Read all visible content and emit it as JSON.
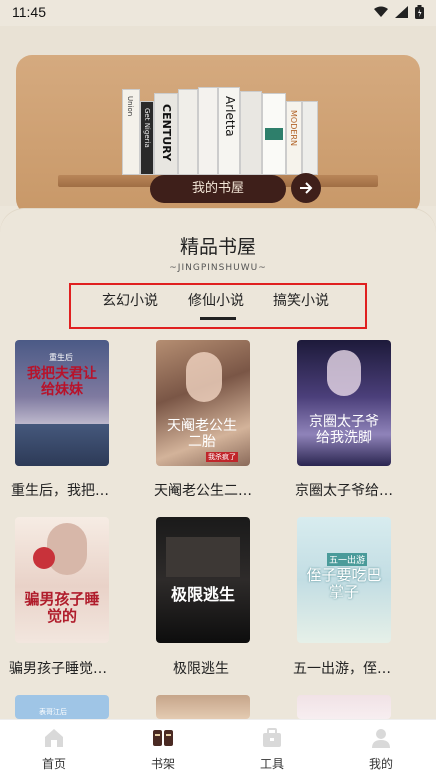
{
  "status": {
    "time": "11:45"
  },
  "banner": {
    "books": [
      "Union",
      "Get Nigeria",
      "CENTURY",
      "",
      "",
      "Arletta",
      "",
      "MODERN",
      ""
    ],
    "shelf_button_label": "我的书屋"
  },
  "section": {
    "title": "精品书屋",
    "subtitle": "~JINGPINSHUWU~"
  },
  "tabs": [
    {
      "label": "玄幻小说"
    },
    {
      "label": "修仙小说"
    },
    {
      "label": "搞笑小说"
    }
  ],
  "books": [
    {
      "title": "重生后，我把…",
      "cover_title": "我把夫君让给妹妹",
      "cover_top": "重生后"
    },
    {
      "title": "天阉老公生二…",
      "cover_title": "天阉老公生二胎",
      "cover_badge": "我杀疯了"
    },
    {
      "title": "京圈太子爷给…",
      "cover_title": "京圈太子爷给我洗脚"
    },
    {
      "title": "骗男孩子睡觉…",
      "cover_title": "骗男孩子睡觉的"
    },
    {
      "title": "极限逃生",
      "cover_title": "极限逃生"
    },
    {
      "title": "五一出游，侄…",
      "cover_title": "侄子要吃巴掌子",
      "cover_top": "五一出游"
    }
  ],
  "partial_covers": [
    {
      "top_text": "表哥江后"
    }
  ],
  "nav": [
    {
      "label": "首页",
      "icon": "home-icon"
    },
    {
      "label": "书架",
      "icon": "bookshelf-icon"
    },
    {
      "label": "工具",
      "icon": "toolbox-icon"
    },
    {
      "label": "我的",
      "icon": "profile-icon"
    }
  ]
}
